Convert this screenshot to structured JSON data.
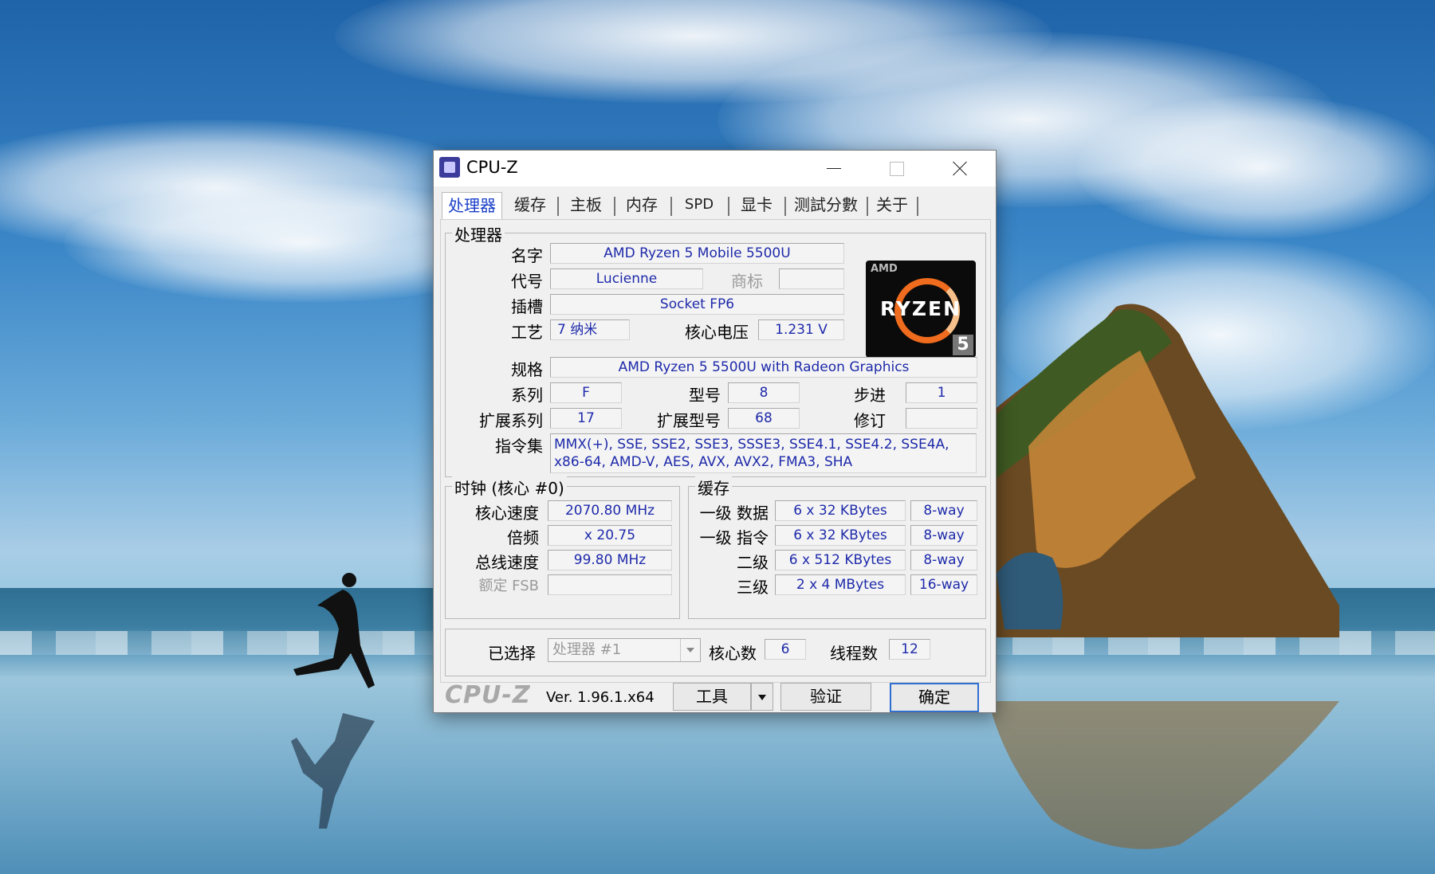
{
  "window": {
    "title": "CPU-Z"
  },
  "tabs": [
    "处理器",
    "缓存",
    "主板",
    "内存",
    "SPD",
    "显卡",
    "测試分數",
    "关于"
  ],
  "processor": {
    "group_label": "处理器",
    "name_label": "名字",
    "name_value": "AMD Ryzen 5 Mobile 5500U",
    "codename_label": "代号",
    "codename_value": "Lucienne",
    "brand_label": "商标",
    "brand_value": "",
    "socket_label": "插槽",
    "socket_value": "Socket FP6",
    "tech_label": "工艺",
    "tech_value": "7 纳米",
    "voltage_label": "核心电压",
    "voltage_value": "1.231 V",
    "spec_label": "规格",
    "spec_value": "AMD Ryzen 5 5500U with Radeon Graphics",
    "family_label": "系列",
    "family_value": "F",
    "model_label": "型号",
    "model_value": "8",
    "stepping_label": "步进",
    "stepping_value": "1",
    "ext_family_label": "扩展系列",
    "ext_family_value": "17",
    "ext_model_label": "扩展型号",
    "ext_model_value": "68",
    "revision_label": "修订",
    "revision_value": "",
    "instructions_label": "指令集",
    "instructions_value": "MMX(+), SSE, SSE2, SSE3, SSSE3, SSE4.1, SSE4.2, SSE4A, x86-64, AMD-V, AES, AVX, AVX2, FMA3, SHA"
  },
  "logo": {
    "brand": "AMD",
    "line": "RYZEN",
    "tier": "5"
  },
  "clocks": {
    "group_label": "时钟 (核心 #0)",
    "core_speed_label": "核心速度",
    "core_speed_value": "2070.80 MHz",
    "multiplier_label": "倍频",
    "multiplier_value": "x 20.75",
    "bus_speed_label": "总线速度",
    "bus_speed_value": "99.80 MHz",
    "rated_fsb_label": "额定 FSB",
    "rated_fsb_value": ""
  },
  "cache": {
    "group_label": "缓存",
    "rows": [
      {
        "label": "一级 数据",
        "size": "6 x 32 KBytes",
        "ways": "8-way"
      },
      {
        "label": "一级 指令",
        "size": "6 x 32 KBytes",
        "ways": "8-way"
      },
      {
        "label": "二级",
        "size": "6 x 512 KBytes",
        "ways": "8-way"
      },
      {
        "label": "三级",
        "size": "2 x 4 MBytes",
        "ways": "16-way"
      }
    ]
  },
  "selection": {
    "selected_label": "已选择",
    "selected_value": "处理器 #1",
    "cores_label": "核心数",
    "cores_value": "6",
    "threads_label": "线程数",
    "threads_value": "12"
  },
  "footer": {
    "brand": "CPU-Z",
    "version": "Ver. 1.96.1.x64",
    "tools_label": "工具",
    "validate_label": "验证",
    "ok_label": "确定"
  }
}
